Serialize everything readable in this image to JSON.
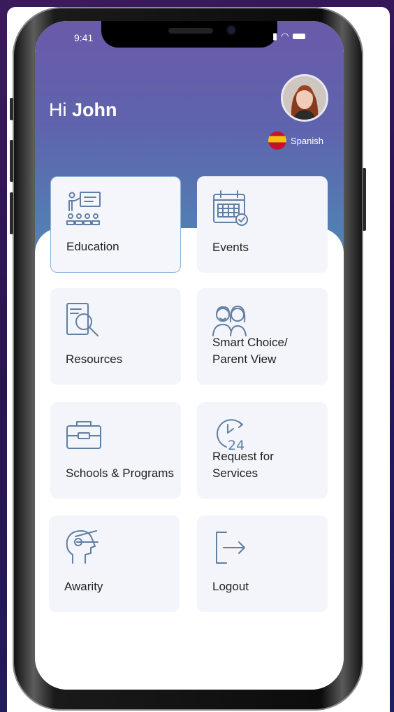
{
  "status_bar": {
    "time": "9:41"
  },
  "header": {
    "greeting_prefix": "Hi",
    "user_name": "John",
    "language_label": "Spanish"
  },
  "tiles": [
    {
      "label": "Education",
      "icon": "teacher-classroom-icon"
    },
    {
      "label": "Events",
      "icon": "calendar-check-icon"
    },
    {
      "label": "Resources",
      "icon": "document-search-icon"
    },
    {
      "label": "Smart Choice/\nParent View",
      "icon": "parents-icon"
    },
    {
      "label": "Schools & Programs",
      "icon": "briefcase-icon"
    },
    {
      "label": "Request for\nServices",
      "icon": "clock-24-icon"
    },
    {
      "label": "Awarity",
      "icon": "head-profile-icon"
    },
    {
      "label": "Logout",
      "icon": "logout-icon"
    }
  ],
  "colors": {
    "header_top": "#6a5aaa",
    "header_bottom": "#4f85b4",
    "tile_bg": "#f4f5fb",
    "icon_stroke": "#5f7fa3"
  }
}
